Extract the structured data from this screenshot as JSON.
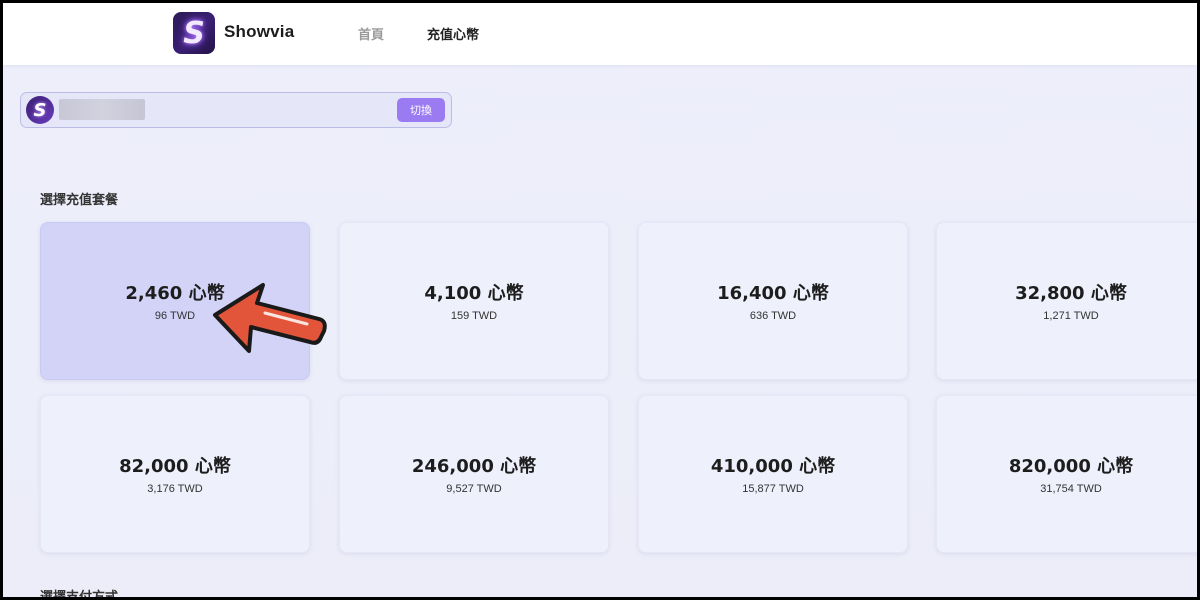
{
  "header": {
    "logo_letter": "S",
    "brand": "Showvia",
    "nav": [
      {
        "label": "首頁",
        "active": false
      },
      {
        "label": "充值心幣",
        "active": true
      }
    ]
  },
  "account": {
    "avatar_letter": "S",
    "switch_label": "切換"
  },
  "section": {
    "packages_title": "選擇充值套餐",
    "payment_title": "選擇支付方式"
  },
  "packages": [
    {
      "coins": "2,460 心幣",
      "price": "96 TWD",
      "selected": true
    },
    {
      "coins": "4,100 心幣",
      "price": "159 TWD",
      "selected": false
    },
    {
      "coins": "16,400 心幣",
      "price": "636 TWD",
      "selected": false
    },
    {
      "coins": "32,800 心幣",
      "price": "1,271 TWD",
      "selected": false
    },
    {
      "coins": "82,000 心幣",
      "price": "3,176 TWD",
      "selected": false
    },
    {
      "coins": "246,000 心幣",
      "price": "9,527 TWD",
      "selected": false
    },
    {
      "coins": "410,000 心幣",
      "price": "15,877 TWD",
      "selected": false
    },
    {
      "coins": "820,000 心幣",
      "price": "31,754 TWD",
      "selected": false
    }
  ],
  "colors": {
    "selected_card": "#d2d3f7",
    "card": "#eef0fb",
    "accent": "#9b7bf2",
    "arrow": "#e2553a"
  }
}
